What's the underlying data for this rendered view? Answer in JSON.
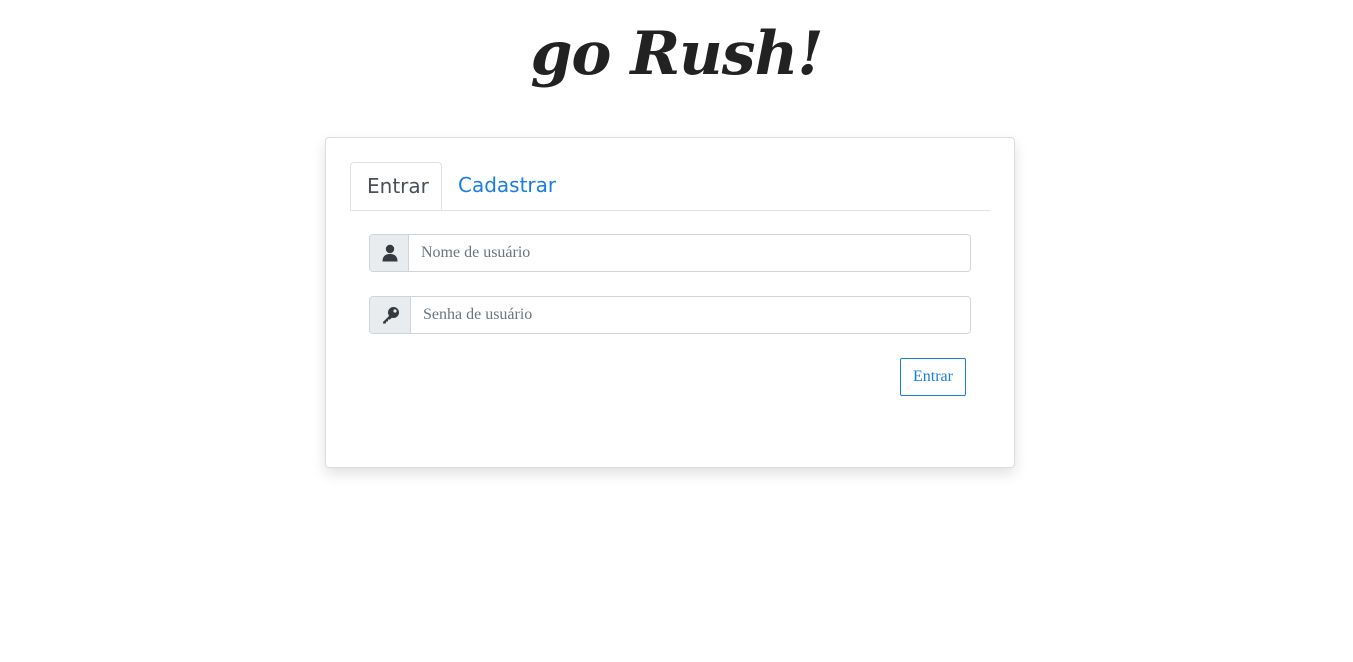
{
  "app": {
    "logo_text": "go Rush!"
  },
  "tabs": [
    {
      "label": "Entrar",
      "active": true
    },
    {
      "label": "Cadastrar",
      "active": false
    }
  ],
  "form": {
    "username": {
      "icon": "user-icon",
      "placeholder": "Nome de usuário",
      "value": ""
    },
    "password": {
      "icon": "key-icon",
      "placeholder": "Senha de usuário",
      "value": ""
    },
    "submit_label": "Entrar"
  },
  "colors": {
    "accent": "#1a7ee0",
    "text_dark": "#222222",
    "addon_bg": "#e9ecef",
    "border": "#ced4da"
  }
}
